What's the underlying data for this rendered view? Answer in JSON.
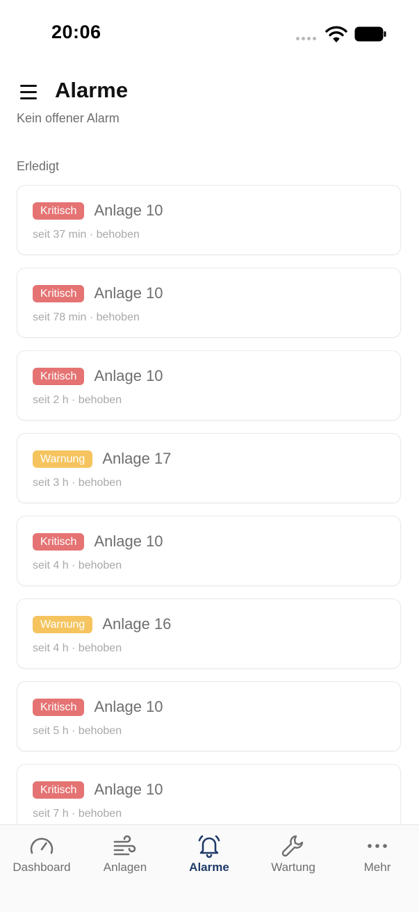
{
  "status_bar": {
    "time": "20:06",
    "icons": [
      "signal-dots-icon",
      "wifi-icon",
      "battery-icon"
    ]
  },
  "header": {
    "menu_icon": "hamburger-menu-icon",
    "title": "Alarme",
    "subtitle": "Kein offener Alarm"
  },
  "section": {
    "label": "Erledigt"
  },
  "alarms": [
    {
      "severity": "Kritisch",
      "level": "critical",
      "plant": "Anlage 10",
      "meta": "seit 37 min · behoben"
    },
    {
      "severity": "Kritisch",
      "level": "critical",
      "plant": "Anlage 10",
      "meta": "seit 78 min · behoben"
    },
    {
      "severity": "Kritisch",
      "level": "critical",
      "plant": "Anlage 10",
      "meta": "seit 2 h · behoben"
    },
    {
      "severity": "Warnung",
      "level": "warning",
      "plant": "Anlage 17",
      "meta": "seit 3 h · behoben"
    },
    {
      "severity": "Kritisch",
      "level": "critical",
      "plant": "Anlage 10",
      "meta": "seit 4 h · behoben"
    },
    {
      "severity": "Warnung",
      "level": "warning",
      "plant": "Anlage 16",
      "meta": "seit 4 h · behoben"
    },
    {
      "severity": "Kritisch",
      "level": "critical",
      "plant": "Anlage 10",
      "meta": "seit 5 h · behoben"
    },
    {
      "severity": "Kritisch",
      "level": "critical",
      "plant": "Anlage 10",
      "meta": "seit 7 h · behoben"
    }
  ],
  "tabs": [
    {
      "label": "Dashboard",
      "icon": "gauge-icon",
      "active": false
    },
    {
      "label": "Anlagen",
      "icon": "wind-icon",
      "active": false
    },
    {
      "label": "Alarme",
      "icon": "bell-icon",
      "active": true
    },
    {
      "label": "Wartung",
      "icon": "wrench-icon",
      "active": false
    },
    {
      "label": "Mehr",
      "icon": "more-dots-icon",
      "active": false
    }
  ],
  "colors": {
    "critical": "#e57373",
    "warning": "#f5c45f",
    "active_tab": "#1f3a68",
    "inactive_tab": "#6e6e6e",
    "muted_text": "#a8a8a8"
  }
}
